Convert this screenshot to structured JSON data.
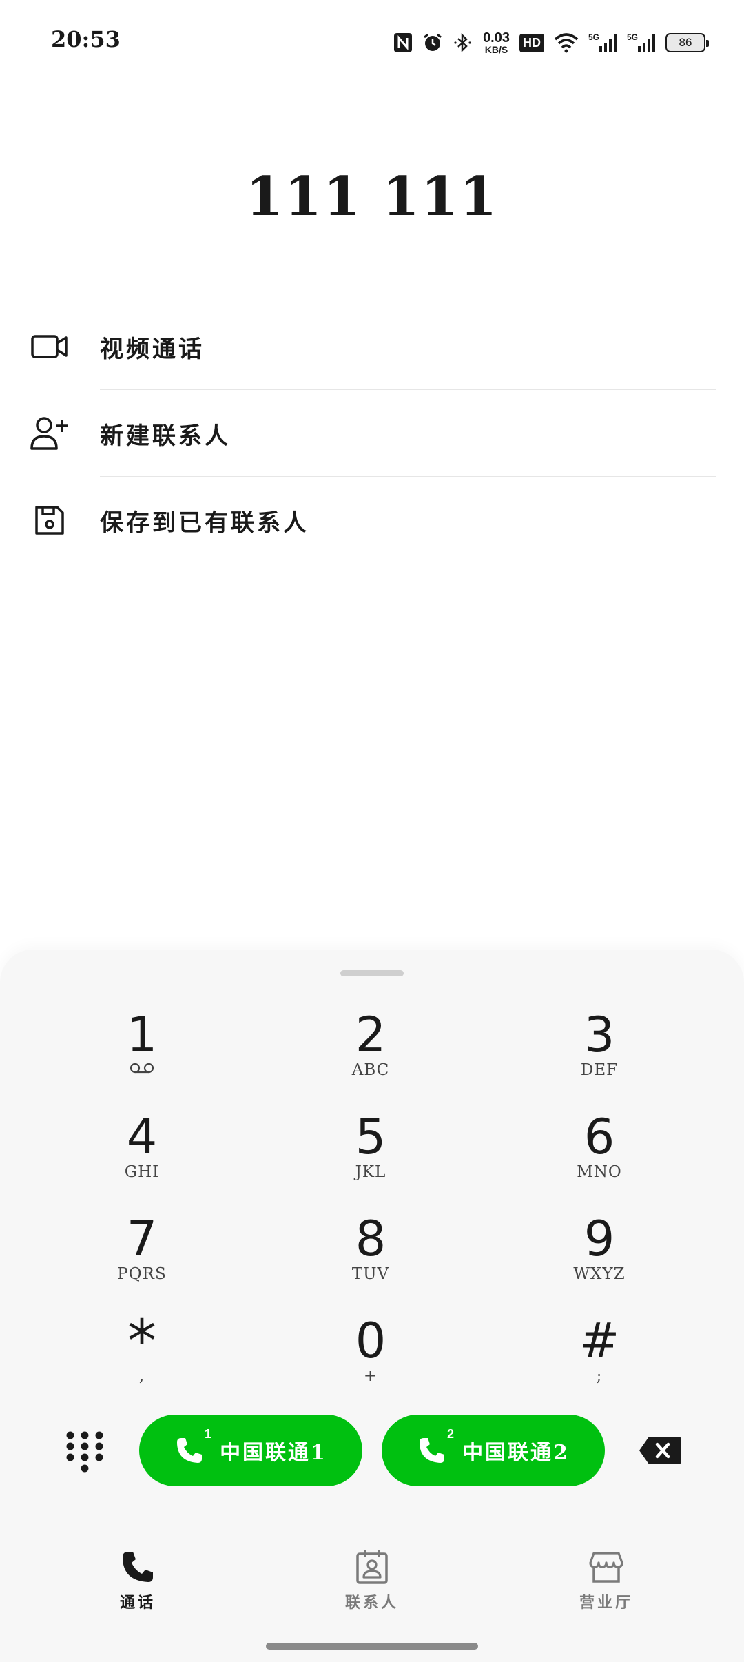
{
  "status_bar": {
    "time": "20:53",
    "net_speed_value": "0.03",
    "net_speed_unit": "KB/S",
    "hd_label": "HD",
    "sim1_signal": "5G",
    "sim2_signal": "5G",
    "battery": "86"
  },
  "dialed_number": "111 111",
  "actions": [
    {
      "label": "视频通话",
      "icon": "video-camera-icon"
    },
    {
      "label": "新建联系人",
      "icon": "add-person-icon"
    },
    {
      "label": "保存到已有联系人",
      "icon": "save-icon"
    }
  ],
  "dialpad": {
    "keys": [
      {
        "digit": "1",
        "letters": ""
      },
      {
        "digit": "2",
        "letters": "ABC"
      },
      {
        "digit": "3",
        "letters": "DEF"
      },
      {
        "digit": "4",
        "letters": "GHI"
      },
      {
        "digit": "5",
        "letters": "JKL"
      },
      {
        "digit": "6",
        "letters": "MNO"
      },
      {
        "digit": "7",
        "letters": "PQRS"
      },
      {
        "digit": "8",
        "letters": "TUV"
      },
      {
        "digit": "9",
        "letters": "WXYZ"
      },
      {
        "digit": "*",
        "letters": ","
      },
      {
        "digit": "0",
        "letters": "+"
      },
      {
        "digit": "#",
        "letters": ";"
      }
    ]
  },
  "call_buttons": [
    {
      "sim": "1",
      "label": "中国联通1"
    },
    {
      "sim": "2",
      "label": "中国联通2"
    }
  ],
  "bottom_nav": [
    {
      "label": "通话",
      "icon": "phone-icon",
      "active": true
    },
    {
      "label": "联系人",
      "icon": "contacts-book-icon",
      "active": false
    },
    {
      "label": "营业厅",
      "icon": "store-icon",
      "active": false
    }
  ],
  "colors": {
    "call_green": "#00c010",
    "sheet_bg": "#f7f7f7",
    "text_primary": "#1a1a1a",
    "nav_inactive": "#7a7a7a"
  }
}
